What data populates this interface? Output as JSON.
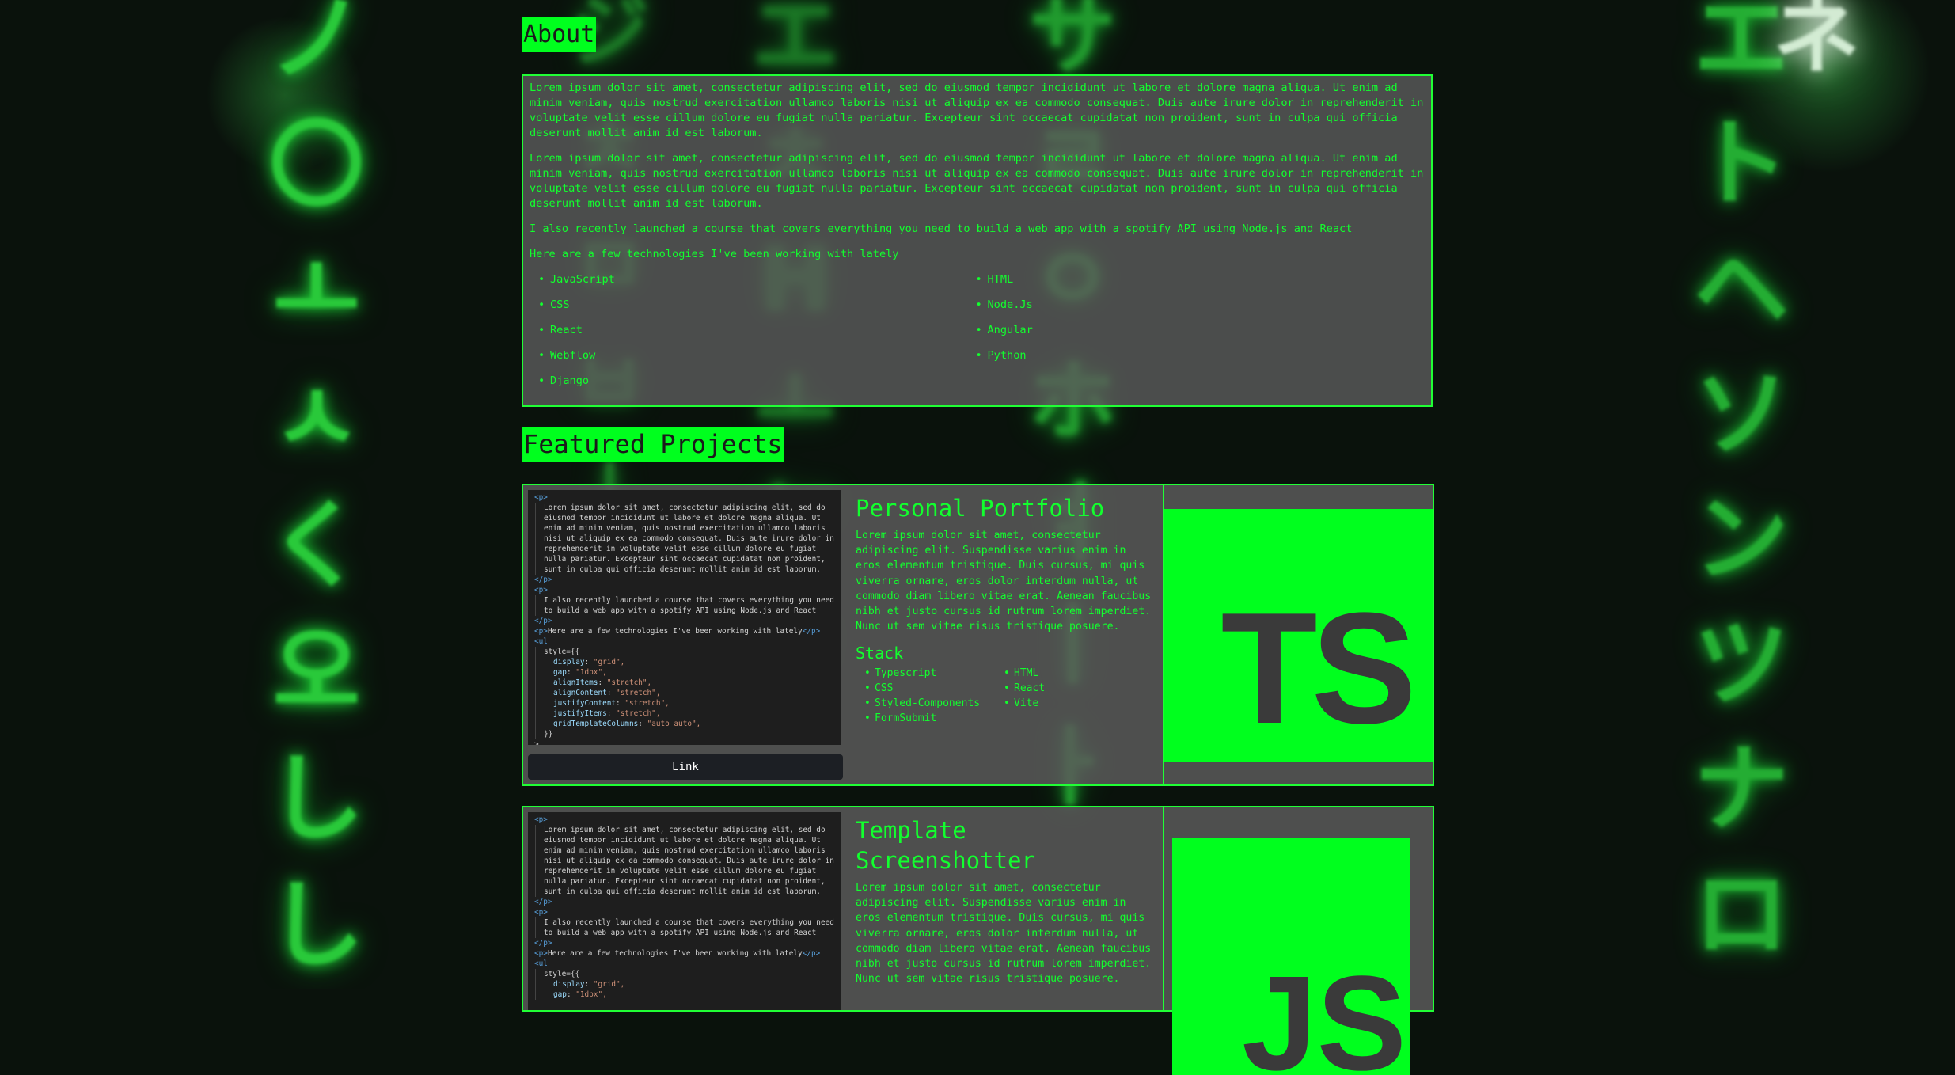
{
  "about": {
    "title": "About",
    "paragraphs": [
      "Lorem ipsum dolor sit amet, consectetur adipiscing elit, sed do eiusmod tempor incididunt ut labore et dolore magna aliqua. Ut enim ad minim veniam, quis nostrud exercitation ullamco laboris nisi ut aliquip ex ea commodo consequat. Duis aute irure dolor in reprehenderit in voluptate velit esse cillum dolore eu fugiat nulla pariatur. Excepteur sint occaecat cupidatat non proident, sunt in culpa qui officia deserunt mollit anim id est laborum.",
      "Lorem ipsum dolor sit amet, consectetur adipiscing elit, sed do eiusmod tempor incididunt ut labore et dolore magna aliqua. Ut enim ad minim veniam, quis nostrud exercitation ullamco laboris nisi ut aliquip ex ea commodo consequat. Duis aute irure dolor in reprehenderit in voluptate velit esse cillum dolore eu fugiat nulla pariatur. Excepteur sint occaecat cupidatat non proident, sunt in culpa qui officia deserunt mollit anim id est laborum.",
      "I also recently launched a course that covers everything you need to build a web app with a spotify API using Node.js and React",
      "Here are a few technologies I've been working with lately"
    ],
    "technologies": [
      "JavaScript",
      "HTML",
      "CSS",
      "Node.Js",
      "React",
      "Angular",
      "Webflow",
      "Python",
      "Django"
    ]
  },
  "featured": {
    "title": "Featured Projects",
    "projects": [
      {
        "name": "Personal Portfolio",
        "description": "Lorem ipsum dolor sit amet, consectetur adipiscing elit. Suspendisse varius enim in eros elementum tristique. Duis cursus, mi quis viverra ornare, eros dolor interdum nulla, ut commodo diam libero vitae erat. Aenean faucibus nibh et justo cursus id rutrum lorem imperdiet. Nunc ut sem vitae risus tristique posuere.",
        "stack_title": "Stack",
        "stack": [
          "Typescript",
          "HTML",
          "CSS",
          "React",
          "Styled-Components",
          "Vite",
          "FormSubmit"
        ],
        "link_label": "Link",
        "logo_text": "TS",
        "logo_icon": "typescript-logo"
      },
      {
        "name": "Template Screenshotter",
        "description": "Lorem ipsum dolor sit amet, consectetur adipiscing elit. Suspendisse varius enim in eros elementum tristique. Duis cursus, mi quis viverra ornare, eros dolor interdum nulla, ut commodo diam libero vitae erat. Aenean faucibus nibh et justo cursus id rutrum lorem imperdiet. Nunc ut sem vitae risus tristique posuere.",
        "logo_text": "JS",
        "logo_icon": "javascript-logo"
      }
    ]
  },
  "snippet": {
    "open_p": "<p>",
    "close_p": "</p>",
    "lorem": "Lorem ipsum dolor sit amet, consectetur adipiscing elit, sed do eiusmod tempor incididunt ut labore et dolore magna aliqua. Ut enim ad minim veniam, quis nostrud exercitation ullamco laboris nisi ut aliquip ex ea commodo consequat. Duis aute irure dolor in reprehenderit in voluptate velit esse cillum dolore eu fugiat nulla pariatur. Excepteur sint occaecat cupidatat non proident, sunt in culpa qui officia deserunt mollit anim id est laborum.",
    "course": "I also recently launched a course that covers everything you need to build a web app with a spotify API using Node.js and React",
    "techline": "Here are a few technologies I've been working with lately",
    "open_ul": "<ul",
    "style_open": "style={{",
    "props": [
      {
        "k": "display",
        "v": "\"grid\","
      },
      {
        "k": "gap",
        "v": "\"1dpx\","
      },
      {
        "k": "alignItems",
        "v": "\"stretch\","
      },
      {
        "k": "alignContent",
        "v": "\"stretch\","
      },
      {
        "k": "justifyContent",
        "v": "\"stretch\","
      },
      {
        "k": "justifyItems",
        "v": "\"stretch\","
      },
      {
        "k": "gridTemplateColumns",
        "v": "\"auto auto\","
      }
    ],
    "style_close": "}}",
    "gt": ">"
  },
  "background": {
    "columns": [
      [
        "ノ",
        "〇",
        "ㅗ",
        "ㅅ",
        "く",
        "오",
        "し",
        "し"
      ],
      [
        "ジ",
        "ㅊ",
        "ㅁ",
        "ㅂ",
        "ㅣ",
        "ㅕ"
      ],
      [
        "エ",
        "ㅊ",
        "H",
        "ㅗ",
        "ヤ",
        "ㄹ"
      ],
      [
        "サ",
        "ㄹ",
        "ㅇ",
        "ホ",
        "ㅕ",
        "ㅣ",
        "ㅏ"
      ],
      [
        "エ",
        "ト",
        "ヘ",
        "ソ",
        "ン",
        "ツ",
        "ナ",
        "ロ"
      ],
      [
        "ネ"
      ]
    ]
  }
}
